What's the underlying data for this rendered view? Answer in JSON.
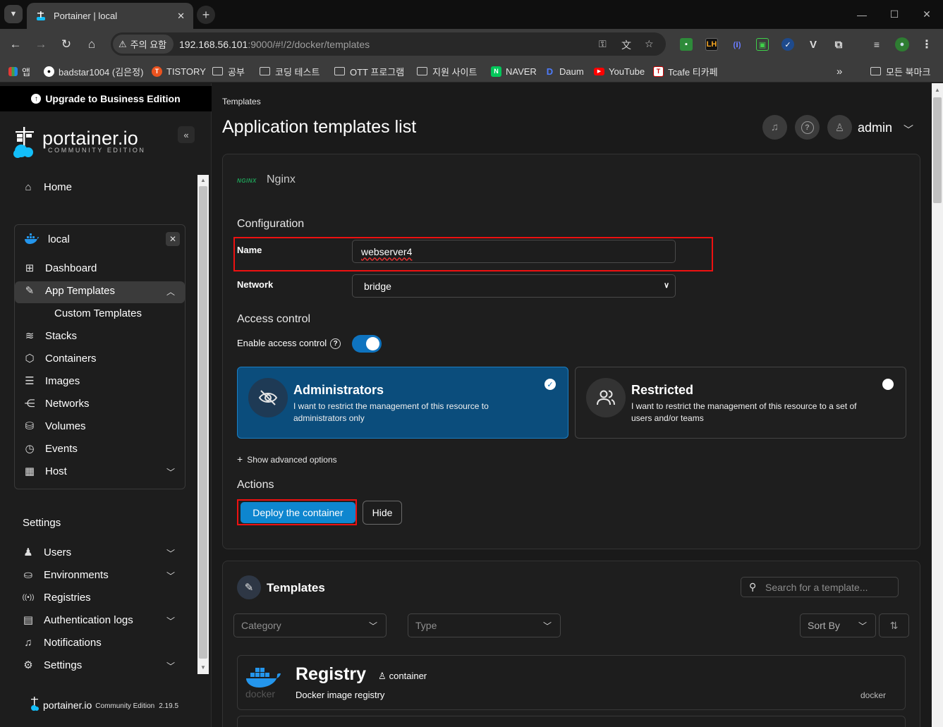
{
  "browser": {
    "tab_title": "Portainer | local",
    "security_chip": "주의 요함",
    "url_host": "192.168.56.101",
    "url_rest": ":9000/#!/2/docker/templates",
    "bookmarks": [
      {
        "label": "앱",
        "icon": "apps-grid-icon"
      },
      {
        "label": "badstar1004 (김은정)",
        "icon": "github-icon"
      },
      {
        "label": "TISTORY",
        "icon": "tistory-icon"
      },
      {
        "label": "공부",
        "icon": "folder-icon"
      },
      {
        "label": "코딩 테스트",
        "icon": "folder-icon"
      },
      {
        "label": "OTT 프로그램",
        "icon": "folder-icon"
      },
      {
        "label": "지원 사이트",
        "icon": "folder-icon"
      },
      {
        "label": "NAVER",
        "icon": "naver-icon"
      },
      {
        "label": "Daum",
        "icon": "daum-icon"
      },
      {
        "label": "YouTube",
        "icon": "youtube-icon"
      },
      {
        "label": "Tcafe 티카페",
        "icon": "tcafe-icon"
      }
    ],
    "all_bookmarks": "모든 북마크"
  },
  "sidebar": {
    "upgrade_label": "Upgrade to Business Edition",
    "brand_name": "portainer.io",
    "brand_sub": "COMMUNITY EDITION",
    "home": "Home",
    "environment": "local",
    "env_items": [
      "Dashboard",
      "App Templates",
      "Custom Templates",
      "Stacks",
      "Containers",
      "Images",
      "Networks",
      "Volumes",
      "Events",
      "Host"
    ],
    "settings_heading": "Settings",
    "settings_items": [
      "Users",
      "Environments",
      "Registries",
      "Authentication logs",
      "Notifications",
      "Settings"
    ],
    "footer_brand": "portainer.io",
    "footer_edition": "Community Edition",
    "footer_version": "2.19.5"
  },
  "header": {
    "breadcrumb": "Templates",
    "title": "Application templates list",
    "user": "admin"
  },
  "form": {
    "template_logo": "NGINX",
    "template_name": "Nginx",
    "configuration_heading": "Configuration",
    "name_label": "Name",
    "name_value": "webserver4",
    "network_label": "Network",
    "network_value": "bridge",
    "access_heading": "Access control",
    "enable_access_label": "Enable access control",
    "enable_access_on": true,
    "admin_title": "Administrators",
    "admin_desc": "I want to restrict the management of this resource to administrators only",
    "restricted_title": "Restricted",
    "restricted_desc": "I want to restrict the management of this resource to a set of users and/or teams",
    "advanced_label": "Show advanced options",
    "actions_heading": "Actions",
    "deploy_label": "Deploy the container",
    "hide_label": "Hide"
  },
  "templates": {
    "heading": "Templates",
    "search_placeholder": "Search for a template...",
    "category_placeholder": "Category",
    "type_placeholder": "Type",
    "sort_label": "Sort By",
    "first": {
      "title": "Registry",
      "type": "container",
      "description": "Docker image registry",
      "platform": "docker"
    }
  },
  "colors": {
    "accent": "#0e86cf",
    "admin_card": "#0b4d7c",
    "highlight": "#e11111"
  }
}
